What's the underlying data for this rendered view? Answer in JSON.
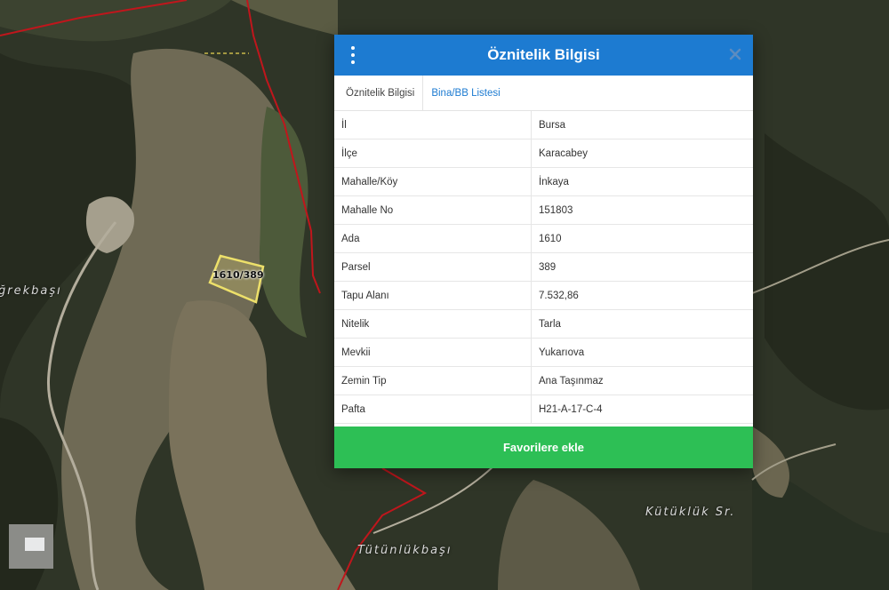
{
  "map": {
    "parcel_label": "1610/389",
    "place_labels": [
      "ğrekbaşı",
      "Tütünlükbaşı",
      "Kütüklük Sr."
    ]
  },
  "dialog": {
    "title": "Öznitelik Bilgisi",
    "tabs": [
      {
        "label": "Öznitelik Bilgisi"
      },
      {
        "label": "Bina/BB Listesi"
      }
    ],
    "rows": [
      {
        "key": "İl",
        "value": "Bursa"
      },
      {
        "key": "İlçe",
        "value": "Karacabey"
      },
      {
        "key": "Mahalle/Köy",
        "value": "İnkaya"
      },
      {
        "key": "Mahalle No",
        "value": "151803"
      },
      {
        "key": "Ada",
        "value": "1610"
      },
      {
        "key": "Parsel",
        "value": "389"
      },
      {
        "key": "Tapu Alanı",
        "value": "7.532,86"
      },
      {
        "key": "Nitelik",
        "value": "Tarla"
      },
      {
        "key": "Mevkii",
        "value": "Yukarıova"
      },
      {
        "key": "Zemin Tip",
        "value": "Ana Taşınmaz"
      },
      {
        "key": "Pafta",
        "value": "H21-A-17-C-4"
      }
    ],
    "favorite_button": "Favorilere ekle",
    "colors": {
      "header": "#1d7bd1",
      "button": "#2dbf55",
      "link": "#1d7bd1"
    }
  }
}
